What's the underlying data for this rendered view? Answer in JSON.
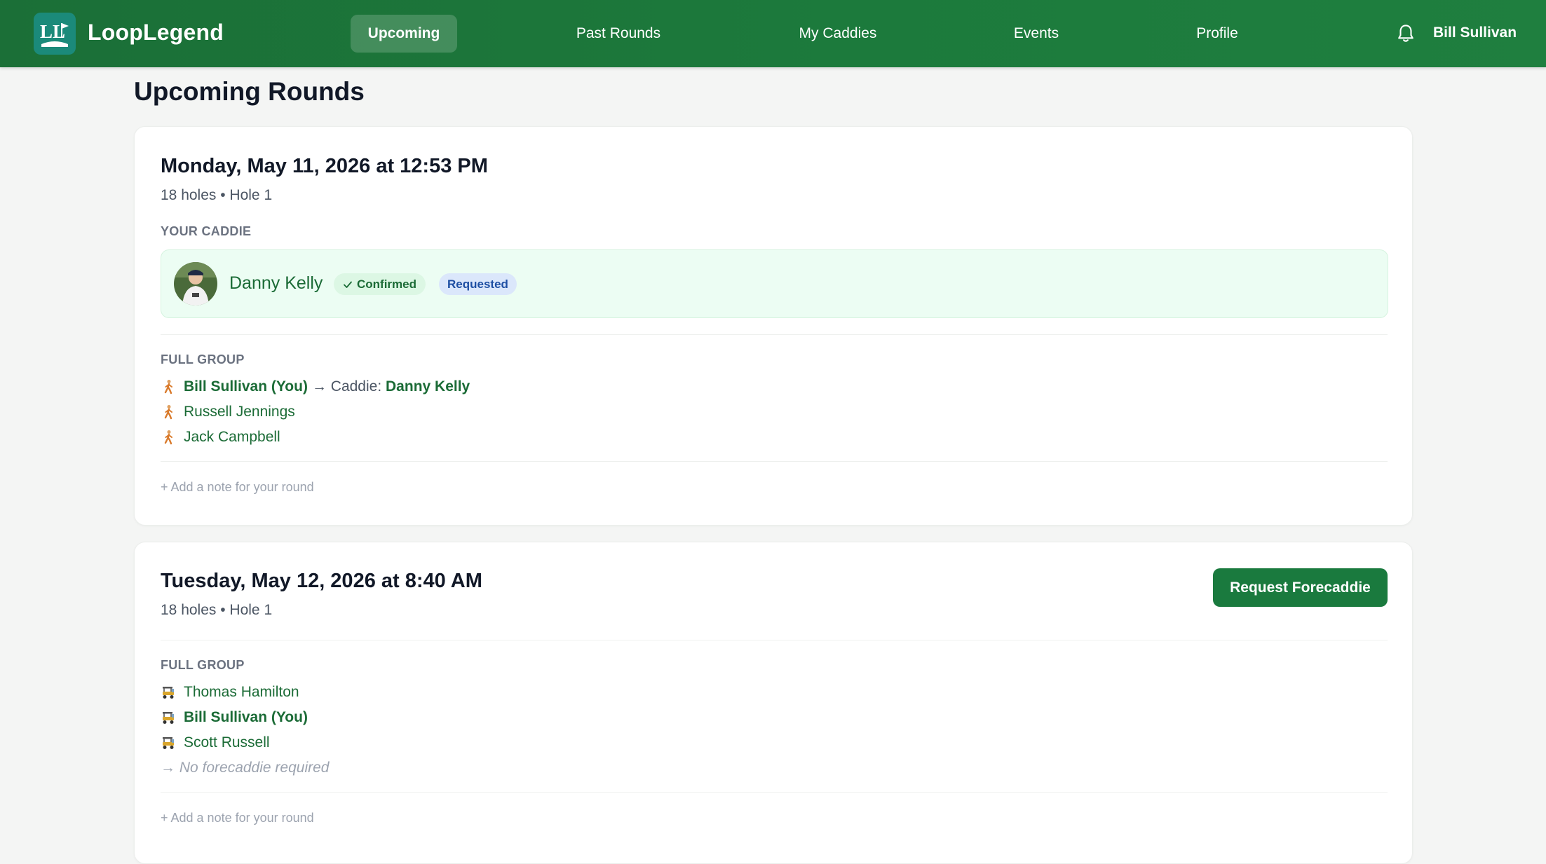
{
  "app": {
    "brand": "LoopLegend"
  },
  "nav": {
    "items": [
      {
        "label": "Upcoming",
        "active": true
      },
      {
        "label": "Past Rounds"
      },
      {
        "label": "My Caddies"
      },
      {
        "label": "Events"
      },
      {
        "label": "Profile"
      }
    ]
  },
  "user": {
    "name": "Bill Sullivan"
  },
  "page": {
    "title": "Upcoming Rounds"
  },
  "rounds": [
    {
      "datetime": "Monday, May 11, 2026 at 12:53 PM",
      "meta": "18 holes • Hole 1",
      "caddie_section_label": "YOUR CADDIE",
      "caddie": {
        "name": "Danny Kelly",
        "status_badge": "Confirmed",
        "request_badge": "Requested"
      },
      "group_label": "FULL GROUP",
      "group": [
        {
          "name": "Bill Sullivan (You)",
          "arrow": "→ Caddie: ",
          "caddie": "Danny Kelly",
          "icon": "walking-icon"
        },
        {
          "name": "Russell Jennings",
          "icon": "walking-icon"
        },
        {
          "name": "Jack Campbell",
          "icon": "walking-icon"
        }
      ],
      "add_note": "+ Add a note for your round"
    },
    {
      "datetime": "Tuesday, May 12, 2026 at 8:40 AM",
      "meta": "18 holes • Hole 1",
      "action_button": "Request Forecaddie",
      "group_label": "FULL GROUP",
      "group": [
        {
          "name": "Thomas Hamilton",
          "icon": "golf-cart-icon"
        },
        {
          "name": "Bill Sullivan (You)",
          "icon": "golf-cart-icon"
        },
        {
          "name": "Scott Russell",
          "icon": "golf-cart-icon"
        }
      ],
      "no_forecaddie": "→ No forecaddie required",
      "add_note": "+ Add a note for your round"
    }
  ],
  "colors": {
    "header_green": "#1c7a3c",
    "accent_green": "#1b6b36",
    "caddie_box_bg": "#ecfdf3",
    "requested_blue": "#1e4fa3"
  }
}
